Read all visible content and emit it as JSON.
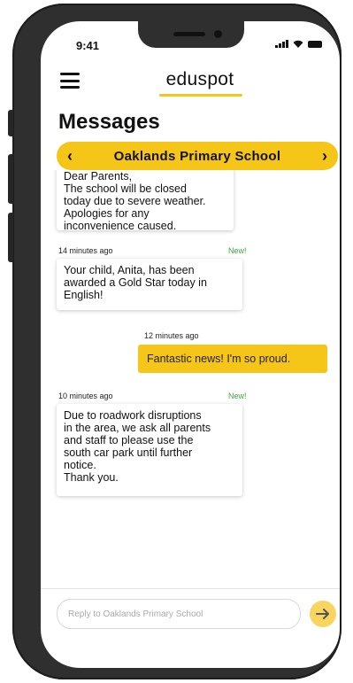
{
  "status_bar": {
    "time": "9:41"
  },
  "header": {
    "brand": "eduspot"
  },
  "page": {
    "title": "Messages"
  },
  "school_selector": {
    "name": "Oaklands Primary School",
    "prev": "‹",
    "next": "›"
  },
  "messages": [
    {
      "text": "Dear Parents,\nThe school will be closed\ntoday due to severe weather.\nApologies for any\ninconvenience caused."
    },
    {
      "timestamp": "14 minutes ago",
      "badge": "New!",
      "text": "Your child, Anita, has been\nawarded a Gold Star today in\nEnglish!"
    },
    {
      "timestamp": "12 minutes ago",
      "text": "Fantastic news! I'm so proud."
    },
    {
      "timestamp": "10 minutes ago",
      "badge": "New!",
      "text": "Due to roadwork disruptions\nin the area, we ask all parents\nand staff to please use the\nsouth car park until further\nnotice.\nThank you."
    }
  ],
  "reply": {
    "placeholder": "Reply to Oaklands Primary School",
    "value": ""
  },
  "colors": {
    "accent": "#f5c518",
    "new_badge": "#3daa3d",
    "frame": "#2f2f2f"
  },
  "icons": {
    "menu": "hamburger-icon",
    "send": "arrow-right-icon",
    "signal": "signal-icon",
    "wifi": "wifi-icon",
    "battery": "battery-icon"
  }
}
